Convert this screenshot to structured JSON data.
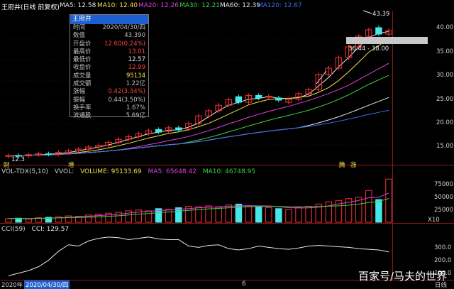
{
  "header": {
    "stock_title": "王府井(日线 前复权)",
    "ma_items": [
      {
        "label": "MA5: 12.58",
        "color": "#e6e6e6"
      },
      {
        "label": "MA10: 12.40",
        "color": "#f0e24a"
      },
      {
        "label": "MA20: 12.26",
        "color": "#e040e0"
      },
      {
        "label": "MA30: 12.21",
        "color": "#40d040"
      },
      {
        "label": "MA60: 12.39",
        "color": "#e6e6e6"
      },
      {
        "label": "MA120: 12.67",
        "color": "#3a6df0"
      }
    ]
  },
  "info_panel": {
    "title": "王府井",
    "rows": [
      {
        "label": "时间",
        "value": "2020/04/30/四",
        "color": "#bfbfbf"
      },
      {
        "label": "数值",
        "value": "43.390",
        "color": "#bfbfbf"
      },
      {
        "label": "开盘价",
        "value": "12.60(0.24%)",
        "color": "#ff4040"
      },
      {
        "label": "最高价",
        "value": "13.01",
        "color": "#ff4040"
      },
      {
        "label": "最低价",
        "value": "12.57",
        "color": "#e6e6e6"
      },
      {
        "label": "收盘价",
        "value": "12.99",
        "color": "#ff4040"
      },
      {
        "label": "成交量",
        "value": "95134",
        "color": "#f0e24a"
      },
      {
        "label": "成交额",
        "value": "1.22亿",
        "color": "#bfbfbf"
      },
      {
        "label": "涨幅",
        "value": "0.42(3.34%)",
        "color": "#ff4040"
      },
      {
        "label": "振幅",
        "value": "0.44(3.50%)",
        "color": "#bfbfbf"
      },
      {
        "label": "换手率",
        "value": "1.67%",
        "color": "#bfbfbf"
      },
      {
        "label": "流通股",
        "value": "5.69亿",
        "color": "#bfbfbf"
      }
    ]
  },
  "price_axis": [
    "40.00",
    "35.00",
    "30.00",
    "25.00",
    "20.00",
    "15.00"
  ],
  "annotations": {
    "high_label": "43.39",
    "range_label": "36.44 - 38.00",
    "left_marker": "12.3",
    "tags": [
      "财",
      "增",
      "腾",
      "涨"
    ]
  },
  "volume_panel": {
    "labels": [
      {
        "text": "VOL-TDX(5,10)",
        "color": "#d0d0d0"
      },
      {
        "text": "VVOL:",
        "color": "#d0d0d0"
      },
      {
        "text": "VOLUME: 95133.69",
        "color": "#f0e24a"
      },
      {
        "text": "MA5: 65648.42",
        "color": "#e040e0"
      },
      {
        "text": "MA10: 46748.95",
        "color": "#40d040"
      }
    ],
    "axis": [
      "75000",
      "50000",
      "25000"
    ],
    "unit": "X10"
  },
  "cci_panel": {
    "labels": [
      {
        "text": "CCI(59)",
        "color": "#d0d0d0"
      },
      {
        "text": "CCI: 129.57",
        "color": "#e6e6e6"
      }
    ],
    "axis": [
      "300.0",
      "200.0",
      "100.0"
    ]
  },
  "bottom_bar": {
    "year": "2020年",
    "date": "2020/04/30/四",
    "month_marker": "6",
    "period": "日线"
  },
  "watermark": "百家号/马夫的世界",
  "chart_data": {
    "type": "candlestick",
    "series_candles": [
      {
        "o": 12.3,
        "c": 12.5
      },
      {
        "o": 12.5,
        "c": 12.4
      },
      {
        "o": 12.4,
        "c": 12.7
      },
      {
        "o": 12.7,
        "c": 12.9
      },
      {
        "o": 12.9,
        "c": 12.8
      },
      {
        "o": 12.8,
        "c": 13.2
      },
      {
        "o": 13.2,
        "c": 13.6
      },
      {
        "o": 13.6,
        "c": 14.0
      },
      {
        "o": 14.0,
        "c": 14.5
      },
      {
        "o": 14.5,
        "c": 14.9
      },
      {
        "o": 14.9,
        "c": 15.6
      },
      {
        "o": 15.6,
        "c": 16.3
      },
      {
        "o": 16.3,
        "c": 16.9
      },
      {
        "o": 16.9,
        "c": 17.6
      },
      {
        "o": 17.6,
        "c": 18.3
      },
      {
        "o": 18.6,
        "c": 18.0
      },
      {
        "o": 18.2,
        "c": 19.0
      },
      {
        "o": 19.0,
        "c": 18.5
      },
      {
        "o": 18.7,
        "c": 20.0
      },
      {
        "o": 20.0,
        "c": 21.8
      },
      {
        "o": 21.8,
        "c": 23.0
      },
      {
        "o": 23.0,
        "c": 24.3
      },
      {
        "o": 24.3,
        "c": 25.6
      },
      {
        "o": 26.3,
        "c": 25.0
      },
      {
        "o": 25.0,
        "c": 26.6
      },
      {
        "o": 26.6,
        "c": 26.0
      },
      {
        "o": 26.2,
        "c": 26.4
      },
      {
        "o": 26.0,
        "c": 25.5
      },
      {
        "o": 25.0,
        "c": 25.7
      },
      {
        "o": 25.7,
        "c": 27.0
      },
      {
        "o": 27.0,
        "c": 28.0
      },
      {
        "o": 28.0,
        "c": 31.5
      },
      {
        "o": 31.5,
        "c": 33.0
      },
      {
        "o": 33.0,
        "c": 35.5
      },
      {
        "o": 35.5,
        "c": 38.0
      },
      {
        "o": 38.0,
        "c": 40.5
      },
      {
        "o": 40.5,
        "c": 42.0
      },
      {
        "o": 42.5,
        "c": 41.0
      },
      {
        "o": 41.0,
        "c": 41.8
      }
    ],
    "volumes": [
      8000,
      9000,
      7000,
      10000,
      11000,
      12000,
      14000,
      13000,
      16000,
      18000,
      20000,
      22000,
      25000,
      27000,
      25000,
      30000,
      28000,
      32000,
      35000,
      34000,
      36000,
      33000,
      38000,
      40000,
      36000,
      34000,
      32000,
      30000,
      28000,
      33000,
      35000,
      40000,
      45000,
      48000,
      52000,
      55000,
      70000,
      50000,
      95000
    ],
    "cci": [
      20,
      40,
      60,
      90,
      140,
      210,
      260,
      250,
      290,
      310,
      320,
      315,
      300,
      310,
      320,
      305,
      300,
      300,
      250,
      240,
      255,
      260,
      230,
      220,
      230,
      250,
      240,
      230,
      225,
      235,
      250,
      255,
      250,
      245,
      240,
      230,
      225,
      220,
      205
    ]
  }
}
